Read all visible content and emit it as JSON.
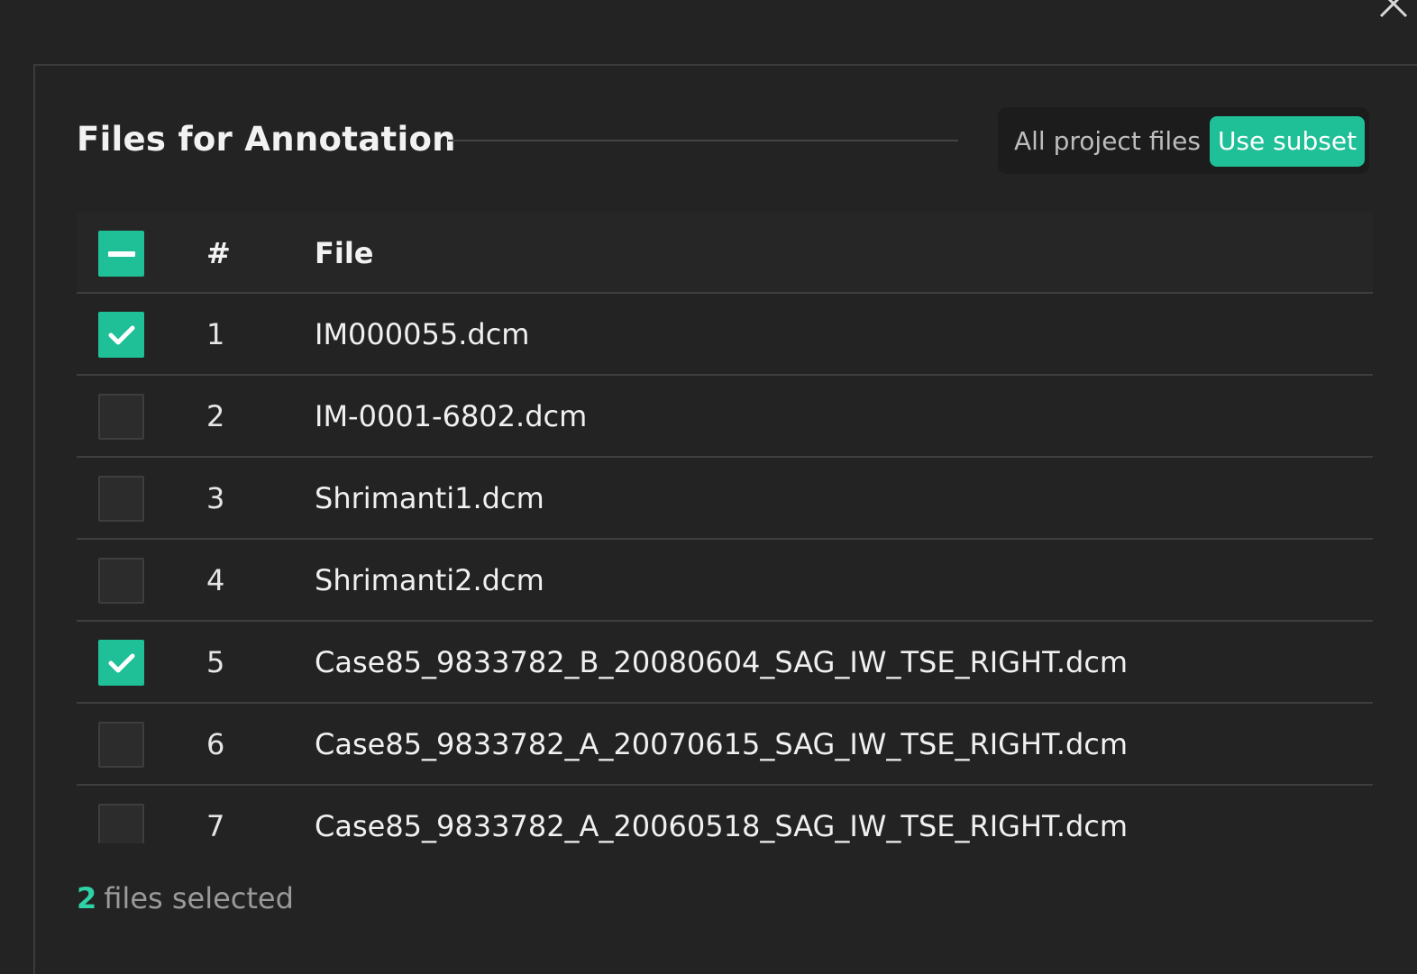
{
  "title": "Files for Annotation",
  "toggle": {
    "all_label": "All project files",
    "subset_label": "Use subset",
    "active": "subset"
  },
  "table": {
    "columns": {
      "number": "#",
      "file": "File"
    },
    "header_checkbox_state": "indeterminate",
    "rows": [
      {
        "num": "1",
        "file": "IM000055.dcm",
        "checked": true
      },
      {
        "num": "2",
        "file": "IM-0001-6802.dcm",
        "checked": false
      },
      {
        "num": "3",
        "file": "Shrimanti1.dcm",
        "checked": false
      },
      {
        "num": "4",
        "file": "Shrimanti2.dcm",
        "checked": false
      },
      {
        "num": "5",
        "file": "Case85_9833782_B_20080604_SAG_IW_TSE_RIGHT.dcm",
        "checked": true
      },
      {
        "num": "6",
        "file": "Case85_9833782_A_20070615_SAG_IW_TSE_RIGHT.dcm",
        "checked": false
      },
      {
        "num": "7",
        "file": "Case85_9833782_A_20060518_SAG_IW_TSE_RIGHT.dcm",
        "checked": false
      }
    ]
  },
  "footer": {
    "count": "2",
    "suffix": "files selected"
  },
  "colors": {
    "accent": "#1fbf97",
    "background": "#232323"
  },
  "icons": {
    "close": "close-icon",
    "check": "check-icon",
    "indeterminate": "minus-icon"
  }
}
